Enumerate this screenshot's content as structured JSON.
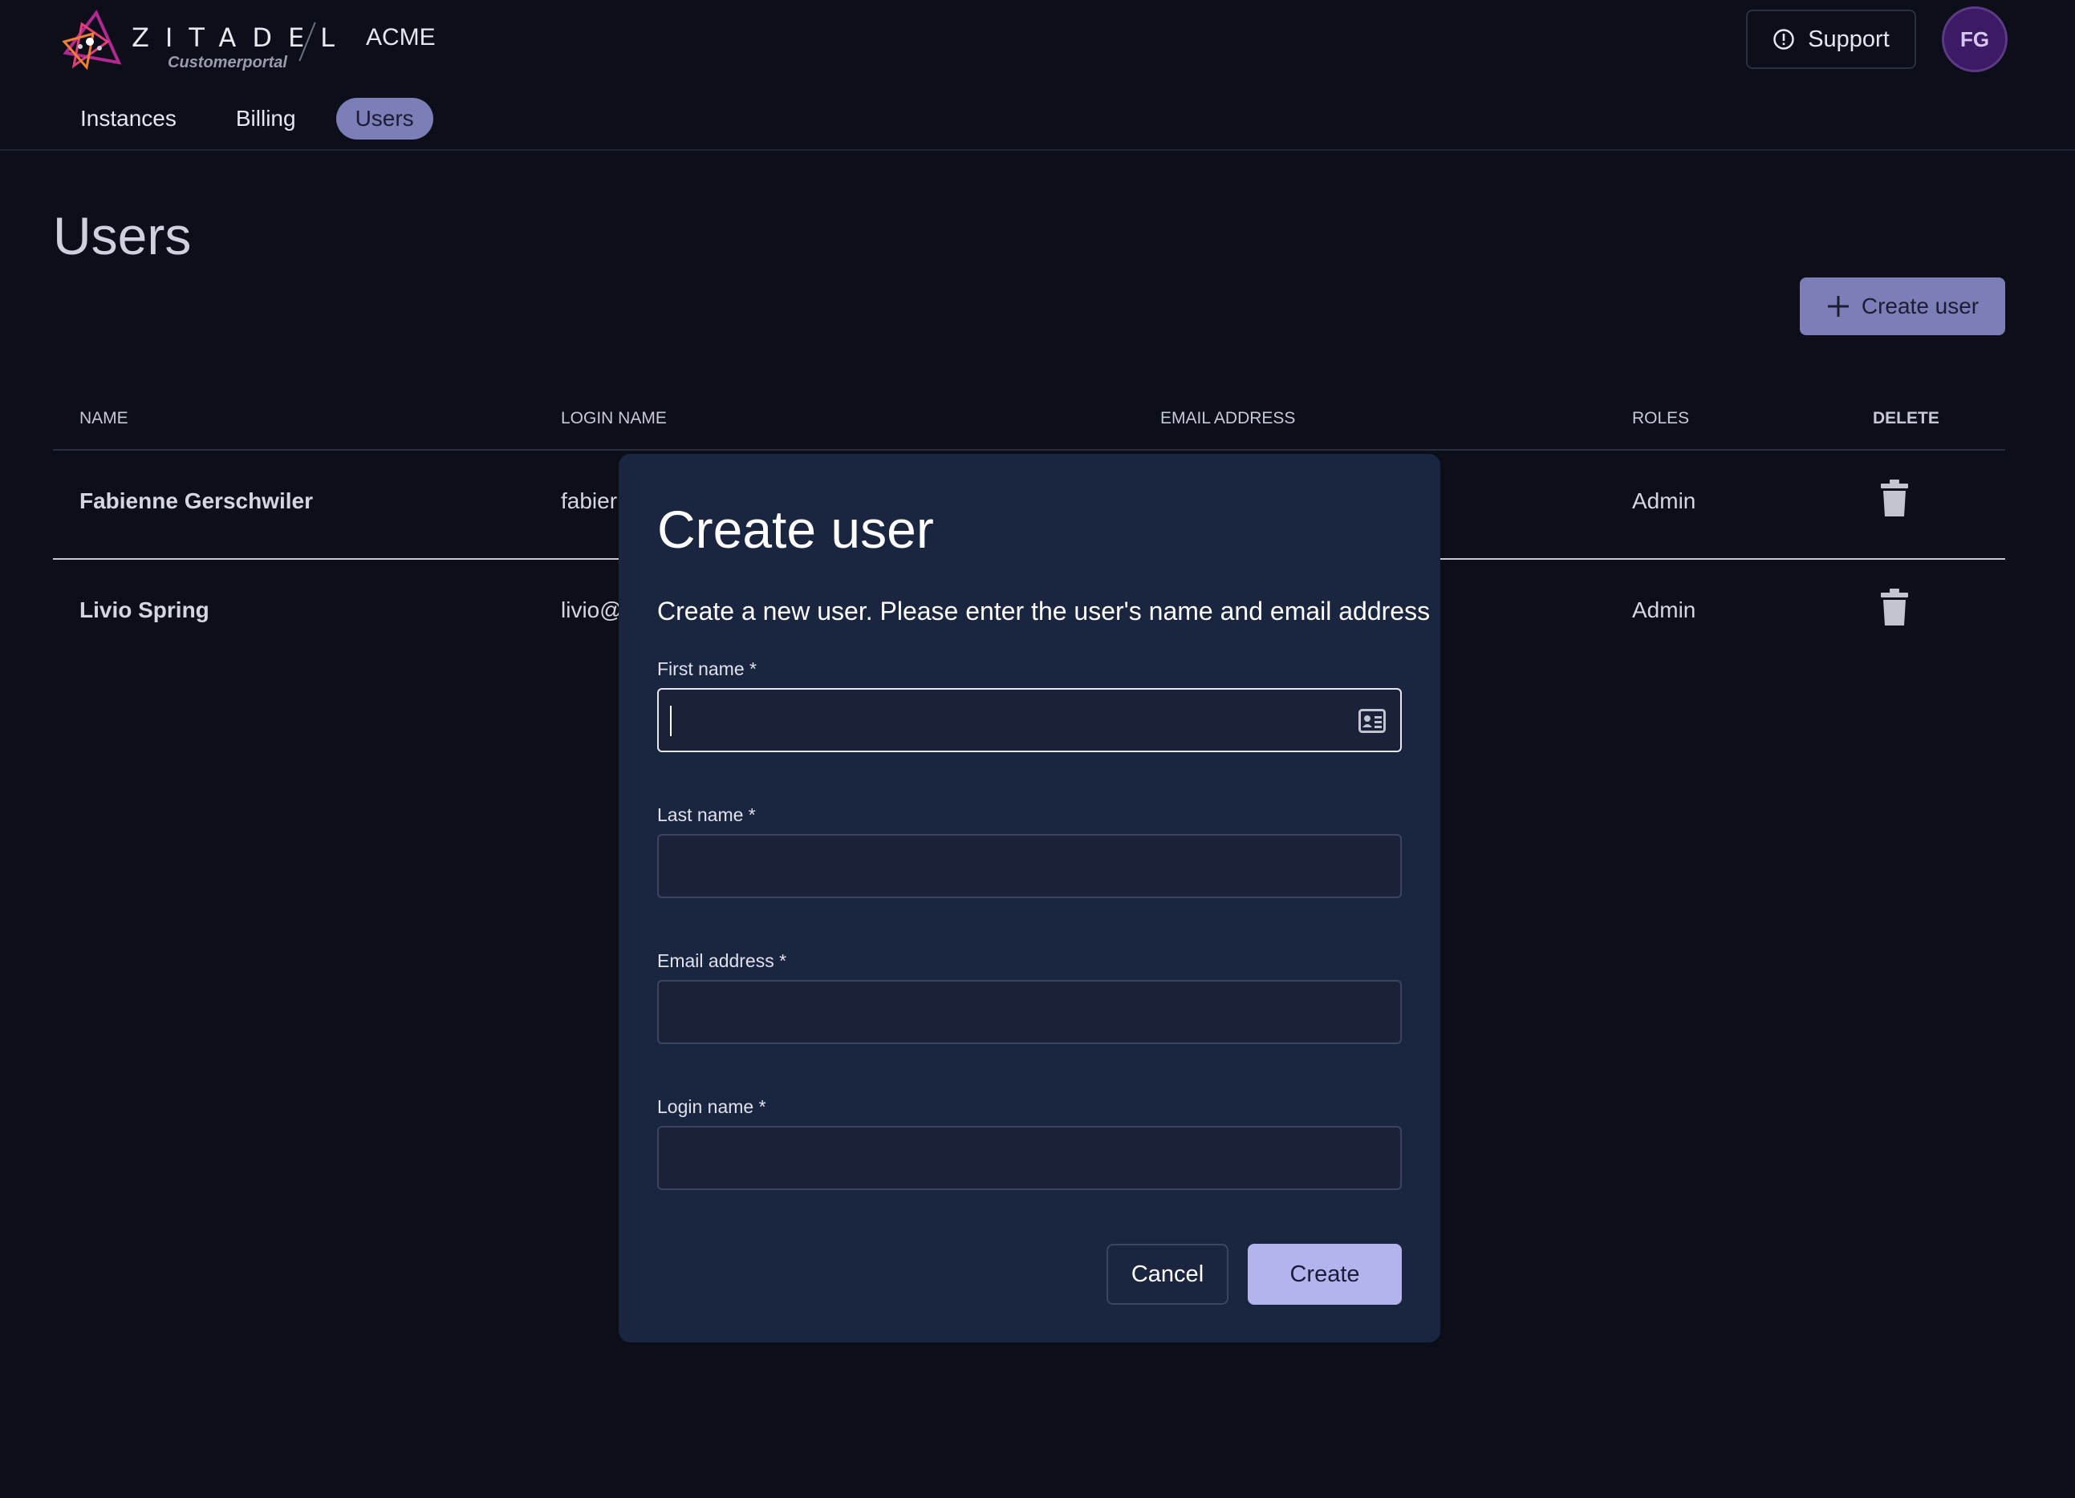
{
  "header": {
    "logo_text": "ZITADEL",
    "logo_subtitle": "Customerportal",
    "org_name": "ACME",
    "support_label": "Support",
    "avatar_initials": "FG"
  },
  "tabs": [
    {
      "label": "Instances",
      "active": false
    },
    {
      "label": "Billing",
      "active": false
    },
    {
      "label": "Users",
      "active": true
    }
  ],
  "page": {
    "title": "Users",
    "create_user_label": "Create user"
  },
  "table": {
    "columns": [
      "NAME",
      "LOGIN NAME",
      "EMAIL ADDRESS",
      "ROLES",
      "DELETE"
    ],
    "rows": [
      {
        "name": "Fabienne Gerschwiler",
        "login": "fabier",
        "role": "Admin"
      },
      {
        "name": "Livio Spring",
        "login": "livio@",
        "role": "Admin"
      }
    ]
  },
  "modal": {
    "title": "Create user",
    "description": "Create a new user. Please enter the user's name and email address",
    "fields": [
      {
        "label": "First name *",
        "value": ""
      },
      {
        "label": "Last name *",
        "value": ""
      },
      {
        "label": "Email address *",
        "value": ""
      },
      {
        "label": "Login name *",
        "value": ""
      }
    ],
    "cancel_label": "Cancel",
    "create_label": "Create"
  },
  "colors": {
    "background": "#0c0f19",
    "modal": "#1a2540",
    "accent": "#7c7eb8",
    "primary_button": "#b3b3ee",
    "avatar": "#3d1a66"
  }
}
